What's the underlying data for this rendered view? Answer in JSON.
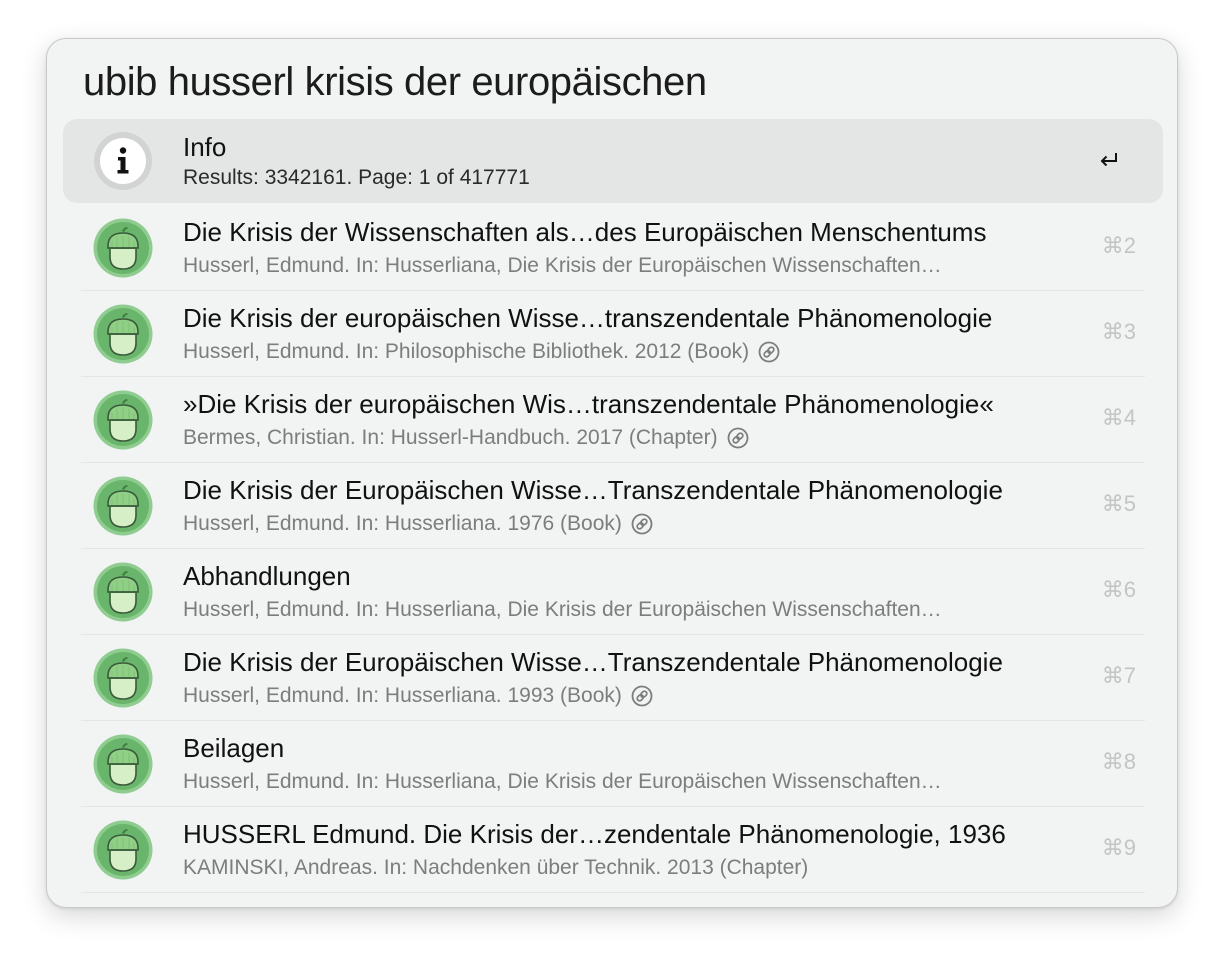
{
  "search": {
    "query": "ubib husserl krisis der europäischen"
  },
  "info_row": {
    "title": "Info",
    "subtitle": "Results: 3342161. Page: 1 of 417771",
    "icon": "info-icon",
    "action_icon": "return-key-icon"
  },
  "results": [
    {
      "title": "Die Krisis der Wissenschaften als…des Europäischen Menschentums",
      "subtitle": "Husserl, Edmund. In: Husserliana, Die Krisis der Europäischen Wissenschaften…",
      "shortcut": "⌘2",
      "link": false
    },
    {
      "title": "Die Krisis der europäischen Wisse…transzendentale Phänomenologie",
      "subtitle": "Husserl, Edmund. In: Philosophische Bibliothek. 2012 (Book)",
      "shortcut": "⌘3",
      "link": true
    },
    {
      "title": "»Die Krisis der europäischen Wis…transzendentale Phänomenologie«",
      "subtitle": "Bermes, Christian. In: Husserl-Handbuch. 2017 (Chapter)",
      "shortcut": "⌘4",
      "link": true
    },
    {
      "title": "Die Krisis der Europäischen Wisse…Transzendentale Phänomenologie",
      "subtitle": "Husserl, Edmund. In: Husserliana. 1976 (Book)",
      "shortcut": "⌘5",
      "link": true
    },
    {
      "title": "Abhandlungen",
      "subtitle": "Husserl, Edmund. In: Husserliana, Die Krisis der Europäischen Wissenschaften…",
      "shortcut": "⌘6",
      "link": false
    },
    {
      "title": "Die Krisis der Europäischen Wisse…Transzendentale Phänomenologie",
      "subtitle": "Husserl, Edmund. In: Husserliana. 1993 (Book)",
      "shortcut": "⌘7",
      "link": true
    },
    {
      "title": "Beilagen",
      "subtitle": "Husserl, Edmund. In: Husserliana, Die Krisis der Europäischen Wissenschaften…",
      "shortcut": "⌘8",
      "link": false
    },
    {
      "title": "HUSSERL Edmund. Die Krisis der…zendentale Phänomenologie, 1936",
      "subtitle": "KAMINSKI, Andreas. In: Nachdenken über Technik. 2013 (Chapter)",
      "shortcut": "⌘9",
      "link": false
    }
  ],
  "icons": {
    "result_icon": "acorn-icon",
    "link_icon": "link-icon"
  },
  "colors": {
    "window_bg": "#f2f3f3",
    "selected_row_bg": "#e4e5e5",
    "acorn_ring": "#8fcc8f",
    "acorn_body": "#d6efc6",
    "acorn_cap": "#8fcf86",
    "subtitle_text": "#7c7d7d",
    "shortcut_text": "#c3c4c4"
  }
}
